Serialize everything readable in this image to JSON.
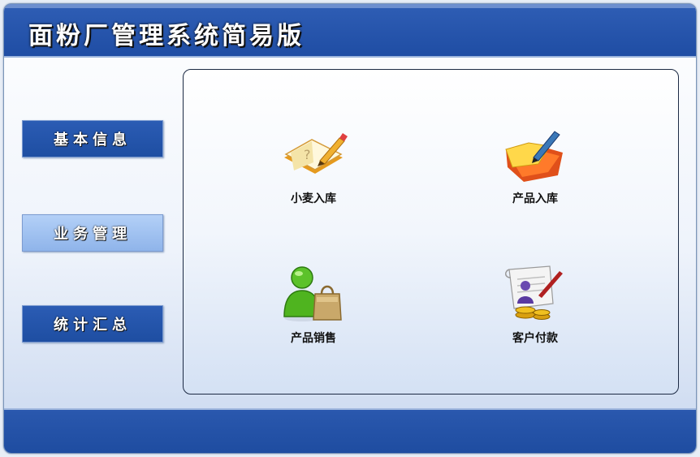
{
  "app": {
    "title": "面粉厂管理系统简易版"
  },
  "sidebar": {
    "items": [
      {
        "label": "基本信息",
        "active": false
      },
      {
        "label": "业务管理",
        "active": true
      },
      {
        "label": "统计汇总",
        "active": false
      }
    ]
  },
  "main": {
    "tiles": [
      {
        "label": "小麦入库",
        "icon": "notebook-pencil-icon"
      },
      {
        "label": "产品入库",
        "icon": "folder-pen-icon"
      },
      {
        "label": "产品销售",
        "icon": "user-shopping-bag-icon"
      },
      {
        "label": "客户付款",
        "icon": "document-coins-icon"
      }
    ]
  },
  "colors": {
    "header": "#2350a8",
    "sidebar_active": "#a7c5f2",
    "footer": "#2350a8"
  }
}
